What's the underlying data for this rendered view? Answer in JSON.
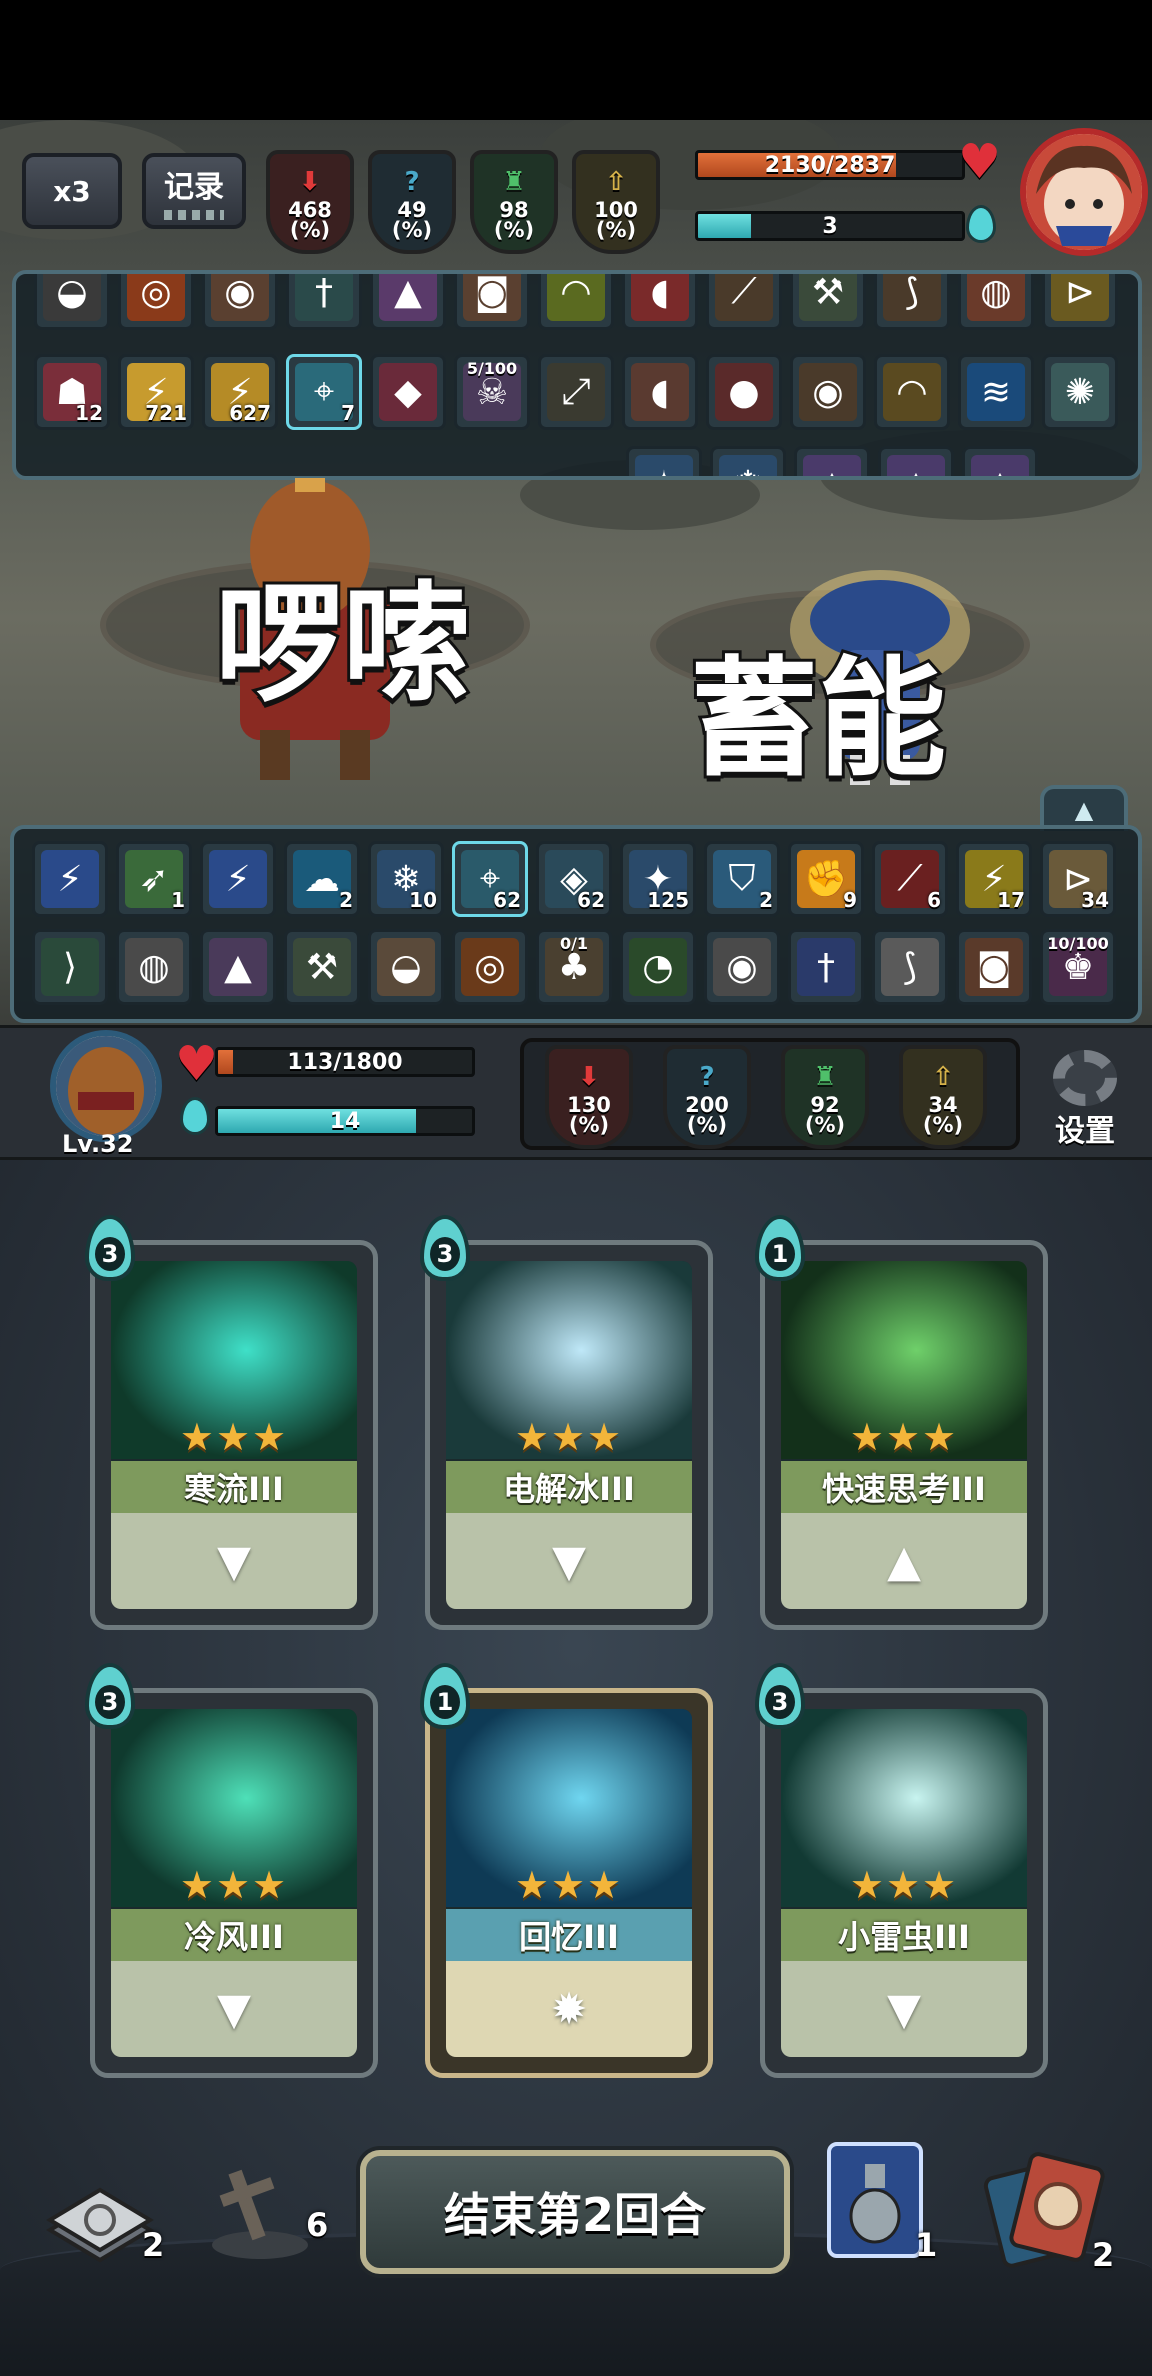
{
  "hud": {
    "speed_label": "x3",
    "log_label": "记录",
    "enemy_stats": [
      {
        "value": "468",
        "unit": "(%)",
        "color": "#e03a3a",
        "icon": "attack-down-icon"
      },
      {
        "value": "49",
        "unit": "(%)",
        "color": "#4aa9c9",
        "icon": "question-icon"
      },
      {
        "value": "98",
        "unit": "(%)",
        "color": "#4fc06a",
        "icon": "defense-icon"
      },
      {
        "value": "100",
        "unit": "(%)",
        "color": "#d6b24a",
        "icon": "buff-icon"
      }
    ],
    "enemy_hp": "2130/2837",
    "enemy_hp_ratio": 0.75,
    "enemy_energy": "3",
    "enemy_energy_ratio": 0.2
  },
  "enemy_tray": {
    "row2": [
      {
        "icon": "curse-icon",
        "count": "12",
        "color": "#7a2e3a"
      },
      {
        "icon": "lightning-icon",
        "count": "721",
        "color": "#c79b2e"
      },
      {
        "icon": "lightning-icon",
        "count": "627",
        "color": "#b58b26"
      },
      {
        "icon": "target-icon",
        "count": "7",
        "color": "#2a6a7a"
      },
      {
        "icon": "gem-icon",
        "count": "",
        "color": "#6a2a3a"
      },
      {
        "icon": "skull-icon",
        "count": "",
        "top": "5/100",
        "color": "#4a3a5a"
      },
      {
        "icon": "musket-icon",
        "count": "",
        "color": "#3a3a30"
      },
      {
        "icon": "meat-icon",
        "count": "",
        "color": "#5a3a30"
      },
      {
        "icon": "tomato-icon",
        "count": "",
        "color": "#5a2a2a"
      },
      {
        "icon": "owl-icon",
        "count": "",
        "color": "#4a3a2a"
      },
      {
        "icon": "banana-icon",
        "count": "",
        "color": "#5a4a20"
      },
      {
        "icon": "wave-icon",
        "count": "",
        "color": "#1a4a7a"
      },
      {
        "icon": "compass-icon",
        "count": "",
        "color": "#3a5a5a"
      }
    ]
  },
  "battle": {
    "enemy_word": "啰嗦",
    "player_word": "蓄能"
  },
  "player_tray": {
    "row1": [
      {
        "icon": "lightning-icon",
        "count": "",
        "color": "#2a4a8a"
      },
      {
        "icon": "wing-icon",
        "count": "1",
        "color": "#3a6a3a"
      },
      {
        "icon": "lightning-icon",
        "count": "",
        "color": "#2a4a8a"
      },
      {
        "icon": "ghost-icon",
        "count": "2",
        "color": "#1a5a7a"
      },
      {
        "icon": "snowflake-icon",
        "count": "10",
        "color": "#2a4a6a"
      },
      {
        "icon": "target-icon",
        "count": "62",
        "color": "#2a5a6a"
      },
      {
        "icon": "mask-icon",
        "count": "62",
        "color": "#2a4a5a"
      },
      {
        "icon": "spark-icon",
        "count": "125",
        "color": "#2a4a6a"
      },
      {
        "icon": "shield-icon",
        "count": "2",
        "color": "#2a5a7a"
      },
      {
        "icon": "fist-icon",
        "count": "9",
        "color": "#c77a1a"
      },
      {
        "icon": "claw-icon",
        "count": "6",
        "color": "#6a2020"
      },
      {
        "icon": "lightning-icon",
        "count": "17",
        "color": "#8a7a1a"
      },
      {
        "icon": "horn-icon",
        "count": "34",
        "color": "#6a5a3a"
      }
    ],
    "row2": [
      {
        "icon": "fish-icon",
        "count": "",
        "color": "#2a4a3a"
      },
      {
        "icon": "pot-icon",
        "count": "",
        "color": "#4a4a4a"
      },
      {
        "icon": "crystal-icon",
        "count": "",
        "color": "#4a3a5a"
      },
      {
        "icon": "axe-icon",
        "count": "",
        "color": "#3a4a3a"
      },
      {
        "icon": "bag-icon",
        "count": "",
        "color": "#5a4a3a"
      },
      {
        "icon": "pumpkin-icon",
        "count": "",
        "color": "#6a3a1a"
      },
      {
        "icon": "mushroom-icon",
        "count": "",
        "top": "0/1",
        "color": "#4a4030"
      },
      {
        "icon": "slime-icon",
        "count": "",
        "color": "#2a4a2a"
      },
      {
        "icon": "orb-icon",
        "count": "",
        "color": "#4a4a4a"
      },
      {
        "icon": "sword-icon",
        "count": "",
        "color": "#2a3a6a"
      },
      {
        "icon": "feather-icon",
        "count": "",
        "color": "#5a5a5a"
      },
      {
        "icon": "drum-icon",
        "count": "",
        "color": "#5a3a2a"
      },
      {
        "icon": "jester-icon",
        "count": "",
        "top": "10/100",
        "color": "#4a2a4a"
      }
    ]
  },
  "player": {
    "level": "Lv.32",
    "hp": "113/1800",
    "hp_ratio": 0.06,
    "energy": "14",
    "energy_ratio": 0.78,
    "stats": [
      {
        "value": "130",
        "unit": "(%)",
        "color": "#e03a3a",
        "icon": "attack-down-icon"
      },
      {
        "value": "200",
        "unit": "(%)",
        "color": "#4aa9c9",
        "icon": "question-icon"
      },
      {
        "value": "92",
        "unit": "(%)",
        "color": "#4fc06a",
        "icon": "defense-icon"
      },
      {
        "value": "34",
        "unit": "(%)",
        "color": "#d6b24a",
        "icon": "buff-icon"
      }
    ],
    "settings_label": "设置"
  },
  "cards": [
    {
      "name": "寒流III",
      "cost": "3",
      "stars": "★★★",
      "foot": "▼",
      "art_colors": [
        "#0f3a2a",
        "#3fe0c8"
      ],
      "gold": false
    },
    {
      "name": "电解冰III",
      "cost": "3",
      "stars": "★★★",
      "foot": "▼",
      "art_colors": [
        "#1a3a3a",
        "#bfe8f8"
      ],
      "gold": false
    },
    {
      "name": "快速思考III",
      "cost": "1",
      "stars": "★★★",
      "foot": "▲",
      "art_colors": [
        "#13301a",
        "#6fd06a"
      ],
      "gold": false
    },
    {
      "name": "冷风III",
      "cost": "3",
      "stars": "★★★",
      "foot": "▼",
      "art_colors": [
        "#0f3a2e",
        "#4ee0b8"
      ],
      "gold": false
    },
    {
      "name": "回忆III",
      "cost": "1",
      "stars": "★★★",
      "foot": "✹",
      "art_colors": [
        "#0e3a55",
        "#6fd6f0"
      ],
      "gold": true
    },
    {
      "name": "小雷虫III",
      "cost": "3",
      "stars": "★★★",
      "foot": "▼",
      "art_colors": [
        "#123a34",
        "#c8f4f0"
      ],
      "gold": false
    }
  ],
  "bottom": {
    "end_turn_label": "结束第2回合",
    "draw_pile_count": "2",
    "grave_count": "6",
    "potion_count": "1",
    "discard_count": "2"
  }
}
